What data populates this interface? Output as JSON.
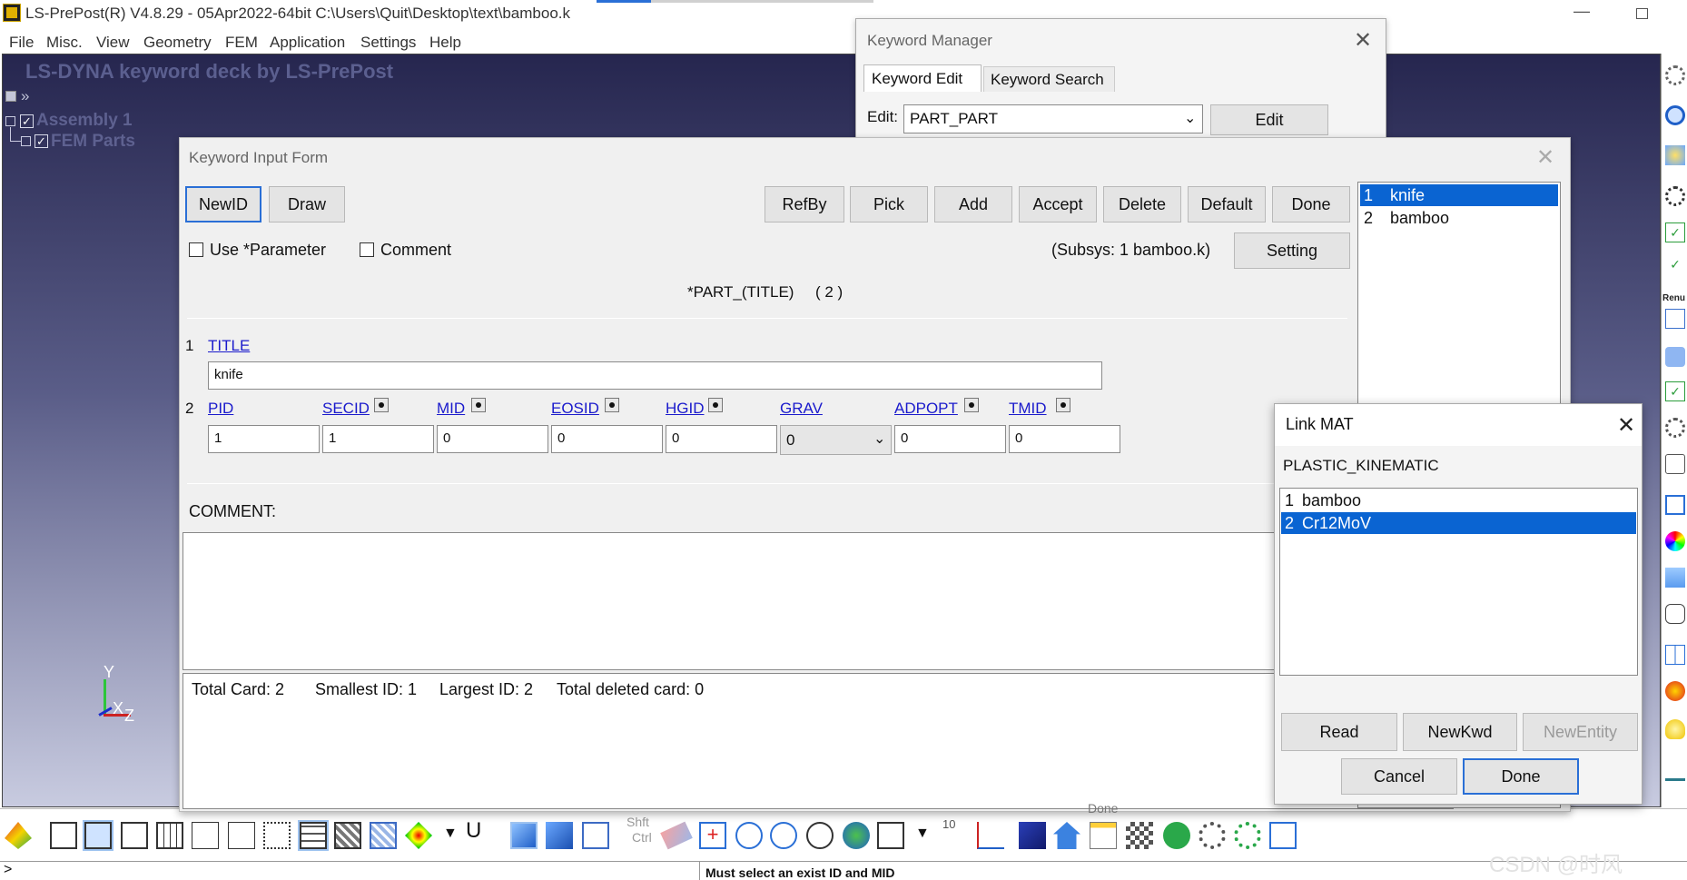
{
  "app": {
    "title": "LS-PrePost(R) V4.8.29 - 05Apr2022-64bit C:\\Users\\Quit\\Desktop\\text\\bamboo.k",
    "menu": [
      "File",
      "Misc.",
      "View",
      "Geometry",
      "FEM",
      "Application",
      "Settings",
      "Help"
    ]
  },
  "tree": {
    "deck_title": "LS-DYNA keyword deck by LS-PrePost",
    "assembly": "Assembly 1",
    "fem_parts": "FEM Parts"
  },
  "axes": {
    "y": "Y",
    "x": "X",
    "z": "Z"
  },
  "keyword_manager": {
    "title": "Keyword Manager",
    "tabs": [
      "Keyword Edit",
      "Keyword Search"
    ],
    "edit_label": "Edit:",
    "edit_value": "PART_PART",
    "edit_button": "Edit"
  },
  "keyword_input_form": {
    "title": "Keyword Input Form",
    "buttons_left": [
      "NewID",
      "Draw"
    ],
    "buttons_right": [
      "RefBy",
      "Pick",
      "Add",
      "Accept",
      "Delete",
      "Default",
      "Done"
    ],
    "use_parameter": "Use *Parameter",
    "comment_check": "Comment",
    "subsys": "(Subsys: 1 bamboo.k)",
    "setting": "Setting",
    "keyword_title": "*PART_(TITLE)",
    "count": "( 2 )",
    "card1_num": "1",
    "card1_label": "TITLE",
    "card1_value": "knife",
    "card2_num": "2",
    "fields": [
      {
        "label": "PID",
        "value": "1"
      },
      {
        "label": "SECID",
        "value": "1"
      },
      {
        "label": "MID",
        "value": "0"
      },
      {
        "label": "EOSID",
        "value": "0"
      },
      {
        "label": "HGID",
        "value": "0"
      },
      {
        "label": "GRAV",
        "value": "0"
      },
      {
        "label": "ADPOPT",
        "value": "0"
      },
      {
        "label": "TMID",
        "value": "0"
      }
    ],
    "comment_label": "COMMENT:",
    "status": {
      "total_card": "Total Card: 2",
      "smallest": "Smallest ID: 1",
      "largest": "Largest ID: 2",
      "deleted": "Total deleted card:  0"
    },
    "parts": [
      {
        "num": "1",
        "name": "knife"
      },
      {
        "num": "2",
        "name": "bamboo"
      }
    ]
  },
  "link_mat": {
    "title": "Link MAT",
    "type": "PLASTIC_KINEMATIC",
    "items": [
      {
        "num": "1",
        "name": "bamboo"
      },
      {
        "num": "2",
        "name": "Cr12MoV"
      }
    ],
    "buttons": [
      "Read",
      "NewKwd",
      "NewEntity"
    ],
    "cancel": "Cancel",
    "done": "Done"
  },
  "toolbar": {
    "shft": "Shft",
    "ctrl": "Ctrl",
    "u_label": "U",
    "ten": "10",
    "hidden_done": "Done"
  },
  "bottom": {
    "prompt": ">",
    "message": "Must select an exist ID and MID"
  },
  "watermark": "CSDN @时风",
  "sidebar_labels": {
    "renu": "Renu"
  },
  "colors": {
    "selection": "#0a64d2",
    "viewport_top": "#26264f",
    "viewport_bottom": "#c8cbe0",
    "link": "#1a1acc"
  }
}
